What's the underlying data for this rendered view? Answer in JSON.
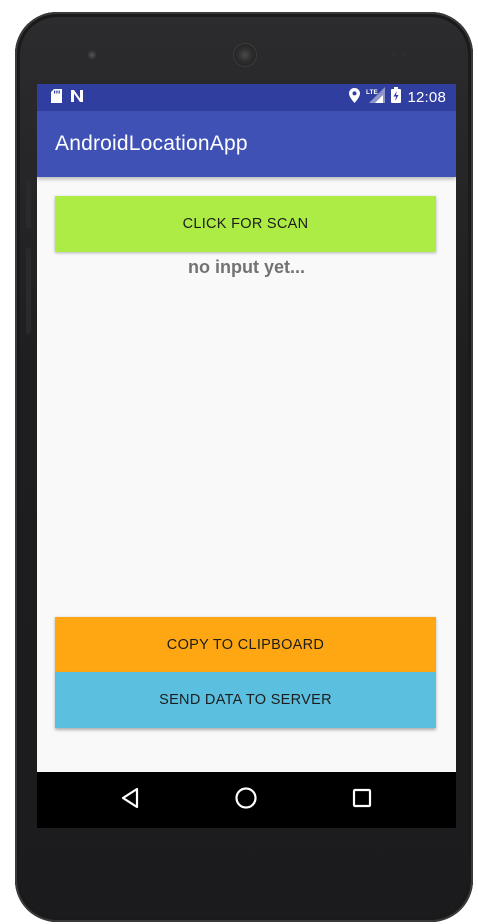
{
  "status_bar": {
    "time": "12:08",
    "left_icons": [
      "sd-card-icon",
      "notification-n-icon"
    ],
    "right_icons": [
      "location-pin-icon",
      "lte-signal-icon",
      "battery-charging-icon"
    ],
    "color": "#303f9f"
  },
  "app_bar": {
    "title": "AndroidLocationApp",
    "color": "#3f51b5"
  },
  "main": {
    "scan_button_label": "CLICK FOR SCAN",
    "scan_button_color": "#adeb45",
    "result_text": "no input yet...",
    "copy_button_label": "COPY TO CLIPBOARD",
    "copy_button_color": "#ffa713",
    "send_button_label": "SEND DATA TO SERVER",
    "send_button_color": "#5bbfe0"
  },
  "nav_bar": {
    "buttons": [
      "back-icon",
      "home-icon",
      "recents-icon"
    ]
  }
}
